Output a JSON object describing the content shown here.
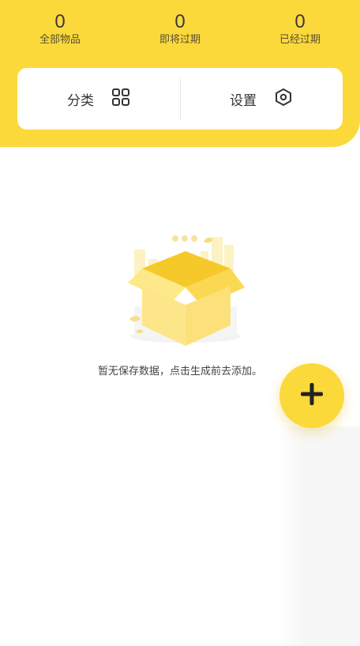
{
  "stats": [
    {
      "count": "0",
      "label": "全部物品"
    },
    {
      "count": "0",
      "label": "即将过期"
    },
    {
      "count": "0",
      "label": "已经过期"
    }
  ],
  "menu": {
    "category_label": "分类",
    "category_icon": "grid-icon",
    "settings_label": "设置",
    "settings_icon": "hexagon-settings-icon"
  },
  "empty_state": {
    "illustration": "open-box-illustration",
    "message": "暂无保存数据，点击生成前去添加。"
  },
  "fab": {
    "icon": "plus-icon"
  },
  "colors": {
    "accent": "#fcd93b",
    "box_light": "#fde98a",
    "box_dark": "#f4c92a"
  }
}
